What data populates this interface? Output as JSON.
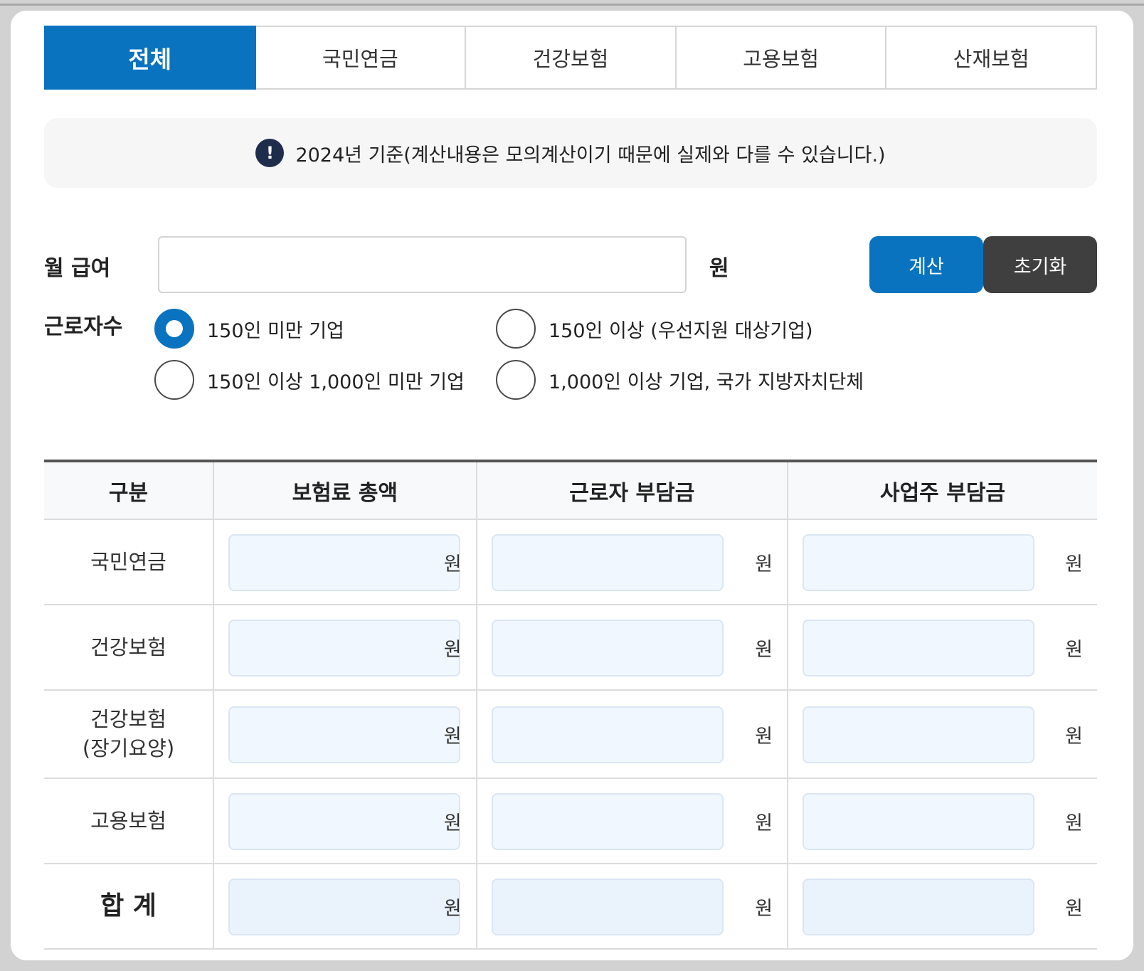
{
  "tabs": [
    {
      "label": "전체",
      "active": true
    },
    {
      "label": "국민연금",
      "active": false
    },
    {
      "label": "건강보험",
      "active": false
    },
    {
      "label": "고용보험",
      "active": false
    },
    {
      "label": "산재보험",
      "active": false
    }
  ],
  "notice": {
    "icon": "!",
    "text": "2024년 기준(계산내용은 모의계산이기 때문에 실제와 다를 수 있습니다.)"
  },
  "salary": {
    "label": "월 급여",
    "value": "",
    "placeholder": "",
    "unit": "원"
  },
  "buttons": {
    "calculate": "계산",
    "reset": "초기화"
  },
  "workers": {
    "label": "근로자수",
    "options": [
      {
        "label": "150인 미만 기업",
        "checked": true
      },
      {
        "label": "150인 이상 (우선지원 대상기업)",
        "checked": false
      },
      {
        "label": "150인 이상 1,000인 미만 기업",
        "checked": false
      },
      {
        "label": "1,000인 이상 기업, 국가 지방자치단체",
        "checked": false
      }
    ]
  },
  "table": {
    "headers": [
      "구분",
      "보험료 총액",
      "근로자 부담금",
      "사업주 부담금"
    ],
    "unit": "원",
    "rows": [
      {
        "label": "국민연금"
      },
      {
        "label": "건강보험"
      },
      {
        "label": "건강보험\n(장기요양)"
      },
      {
        "label": "고용보험"
      },
      {
        "label": "합 계"
      }
    ]
  },
  "colors": {
    "accent": "#0a73bf",
    "reset": "#3f3f3f",
    "notice_icon": "#1f2d4d",
    "output_bg": "#f1f7fe"
  }
}
